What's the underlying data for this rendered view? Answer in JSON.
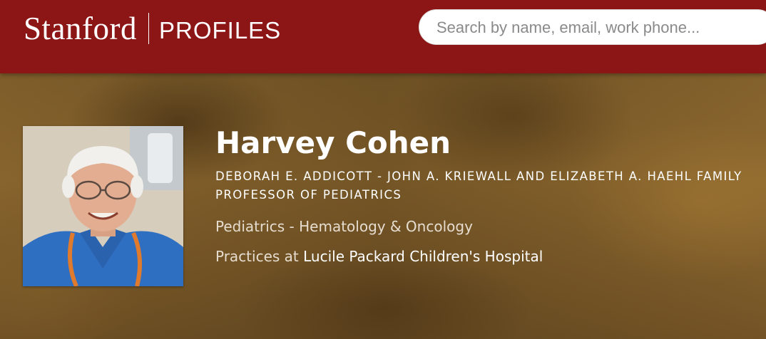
{
  "header": {
    "wordmark": "Stanford",
    "section": "PROFILES",
    "search_placeholder": "Search by name, email, work phone..."
  },
  "profile": {
    "name": "Harvey Cohen",
    "title": "DEBORAH E. ADDICOTT - JOHN A. KRIEWALL AND ELIZABETH A. HAEHL FAMILY PROFESSOR OF PEDIATRICS",
    "department": "Pediatrics - Hematology & Oncology",
    "practice_prefix": "Practices at ",
    "practice_location": "Lucile Packard Children's Hospital"
  },
  "colors": {
    "header_bg": "#8c1515",
    "text_white": "#ffffff",
    "muted_text": "#e6ddd0"
  }
}
